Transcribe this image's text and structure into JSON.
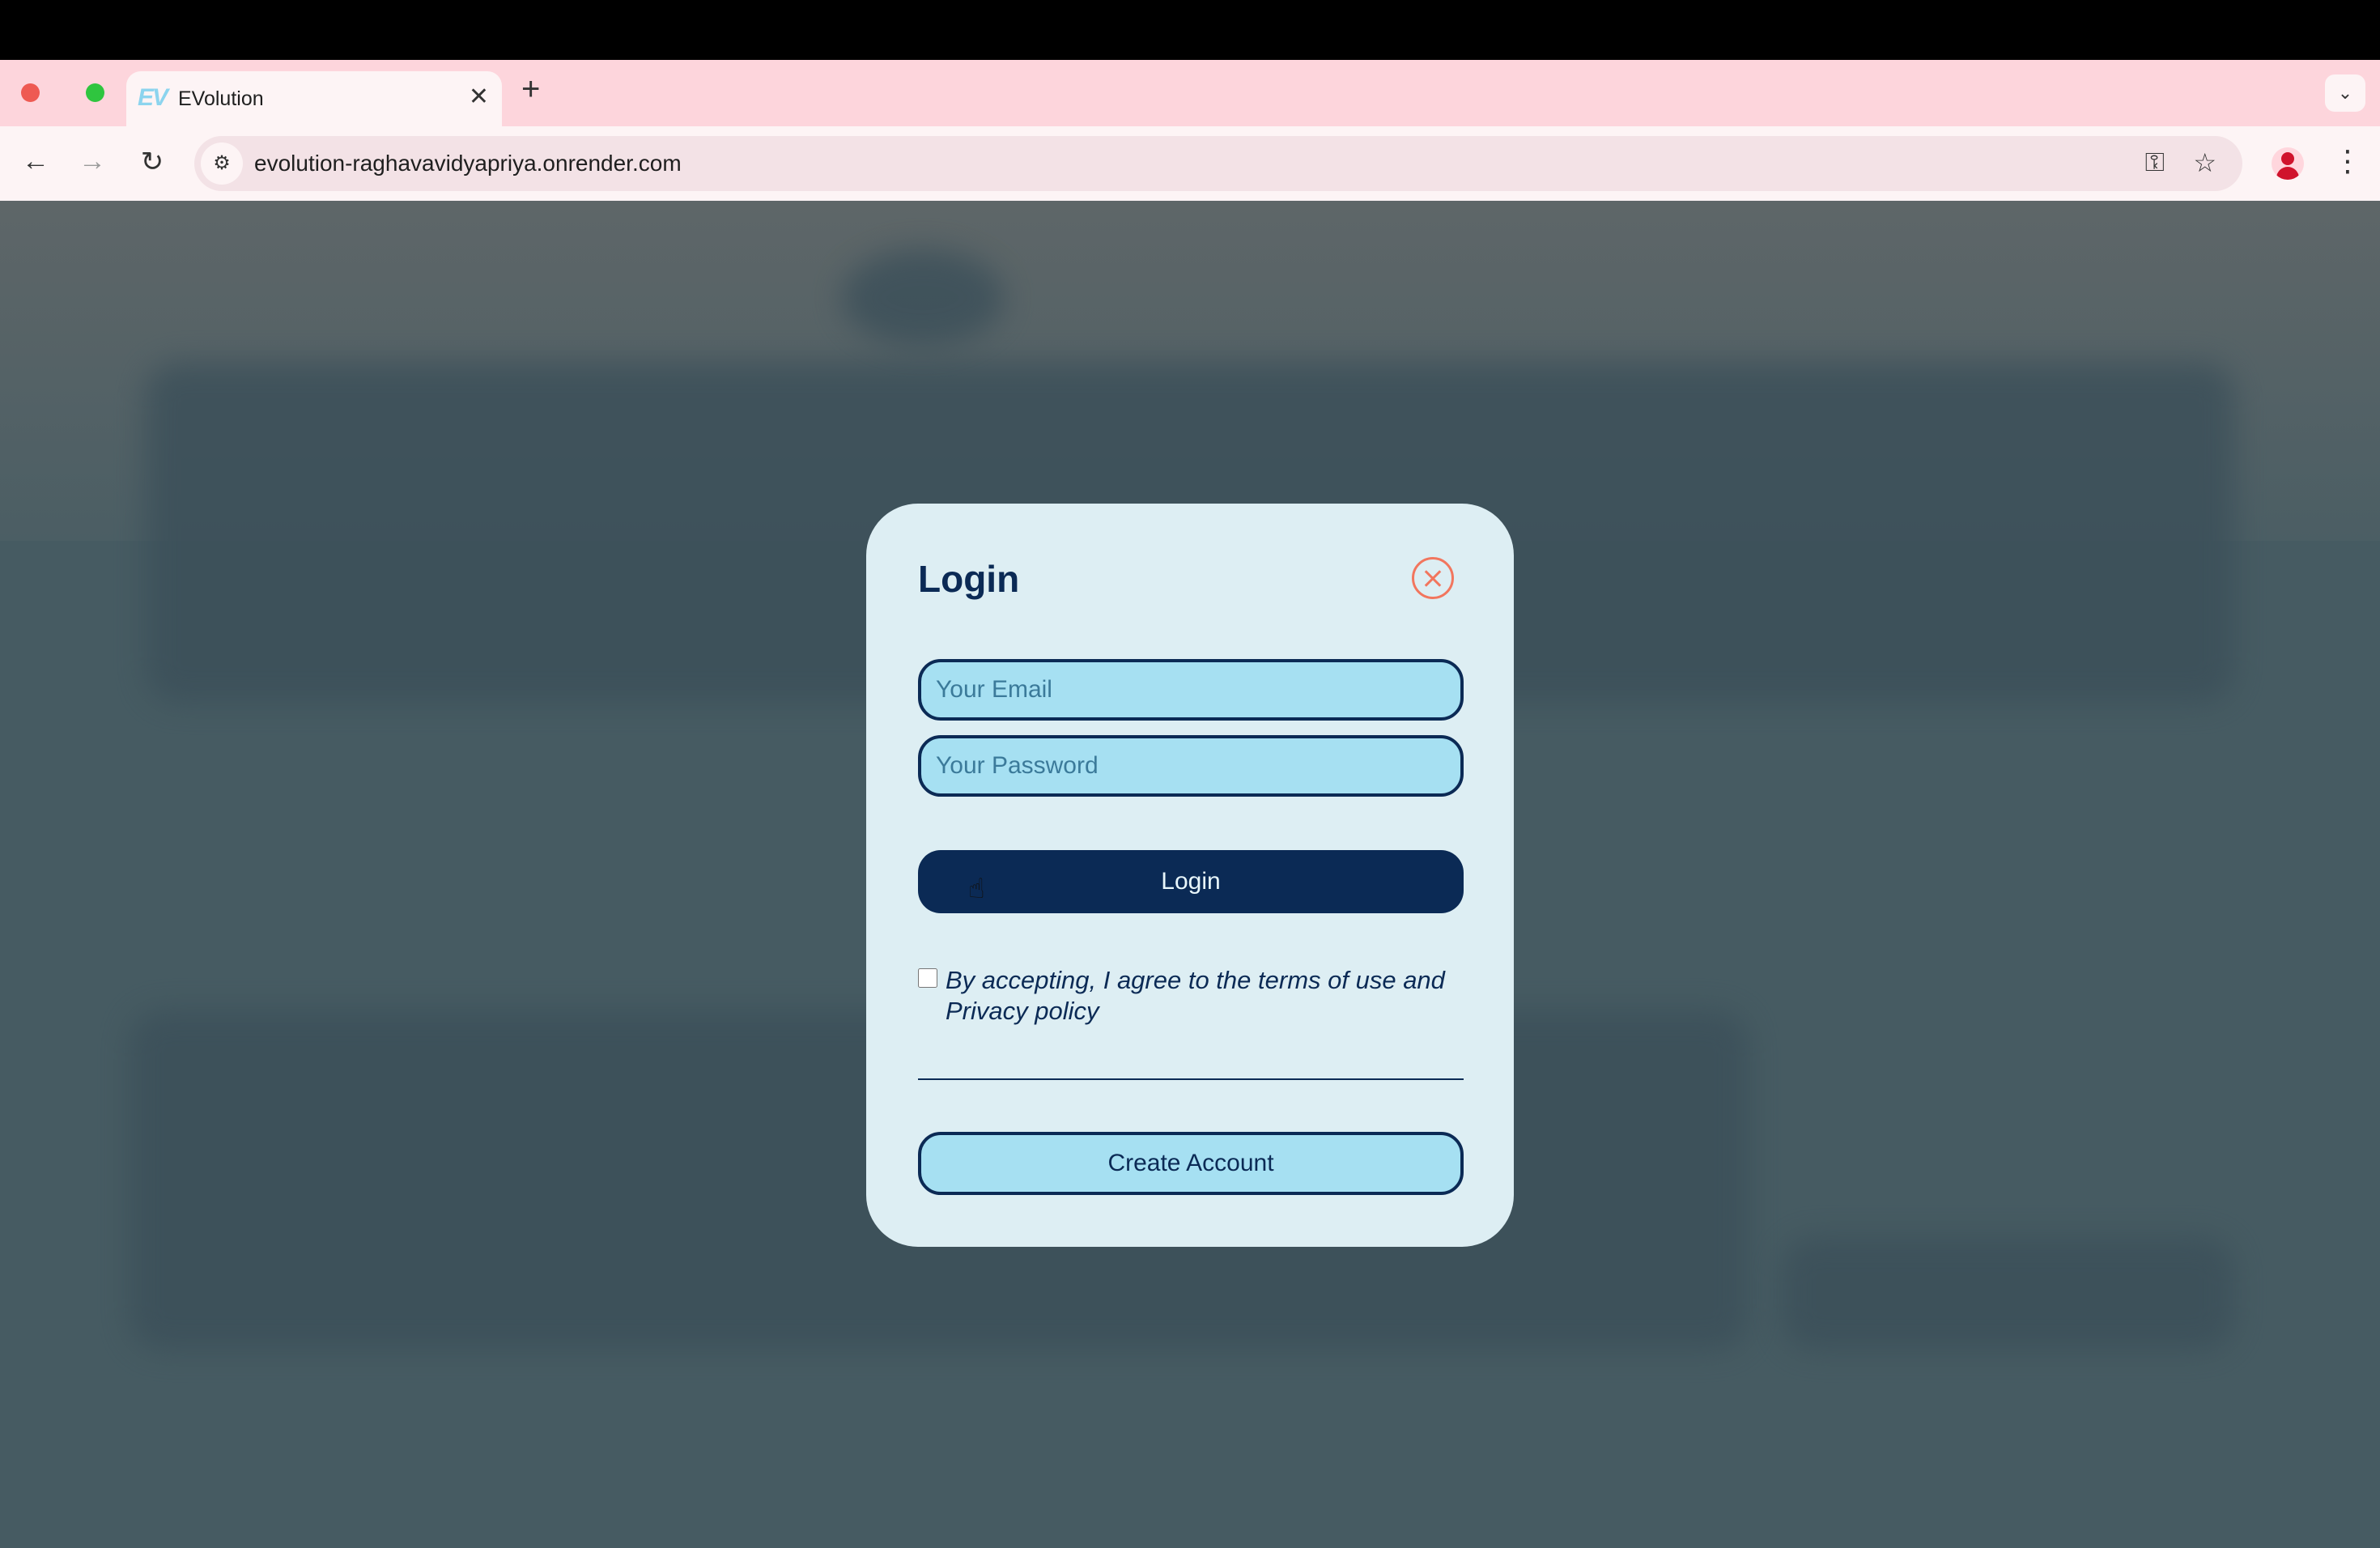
{
  "browser": {
    "tab": {
      "favicon": "EV",
      "title": "EVolution",
      "close_glyph": "✕"
    },
    "new_tab_glyph": "+",
    "tab_search_glyph": "⌄",
    "url": "evolution-raghavavidyapriya.onrender.com",
    "nav": {
      "back": "←",
      "forward": "→",
      "reload": "↻"
    },
    "icons": {
      "site_info": "⚙",
      "password_key": "⚿",
      "bookmark_star": "☆",
      "menu": "⋮"
    }
  },
  "login_modal": {
    "title": "Login",
    "email": {
      "placeholder": "Your Email",
      "value": ""
    },
    "password": {
      "placeholder": "Your Password",
      "value": ""
    },
    "login_label": "Login",
    "terms": {
      "checked": false,
      "text": "By accepting, I agree to the terms of use and Privacy policy"
    },
    "create_account_label": "Create Account"
  },
  "colors": {
    "navy": "#0b2a55",
    "field_bg": "#a6e0f2",
    "modal_bg": "#ddeef3",
    "close_accent": "#f2765e",
    "tab_strip": "#fdd5dc"
  }
}
